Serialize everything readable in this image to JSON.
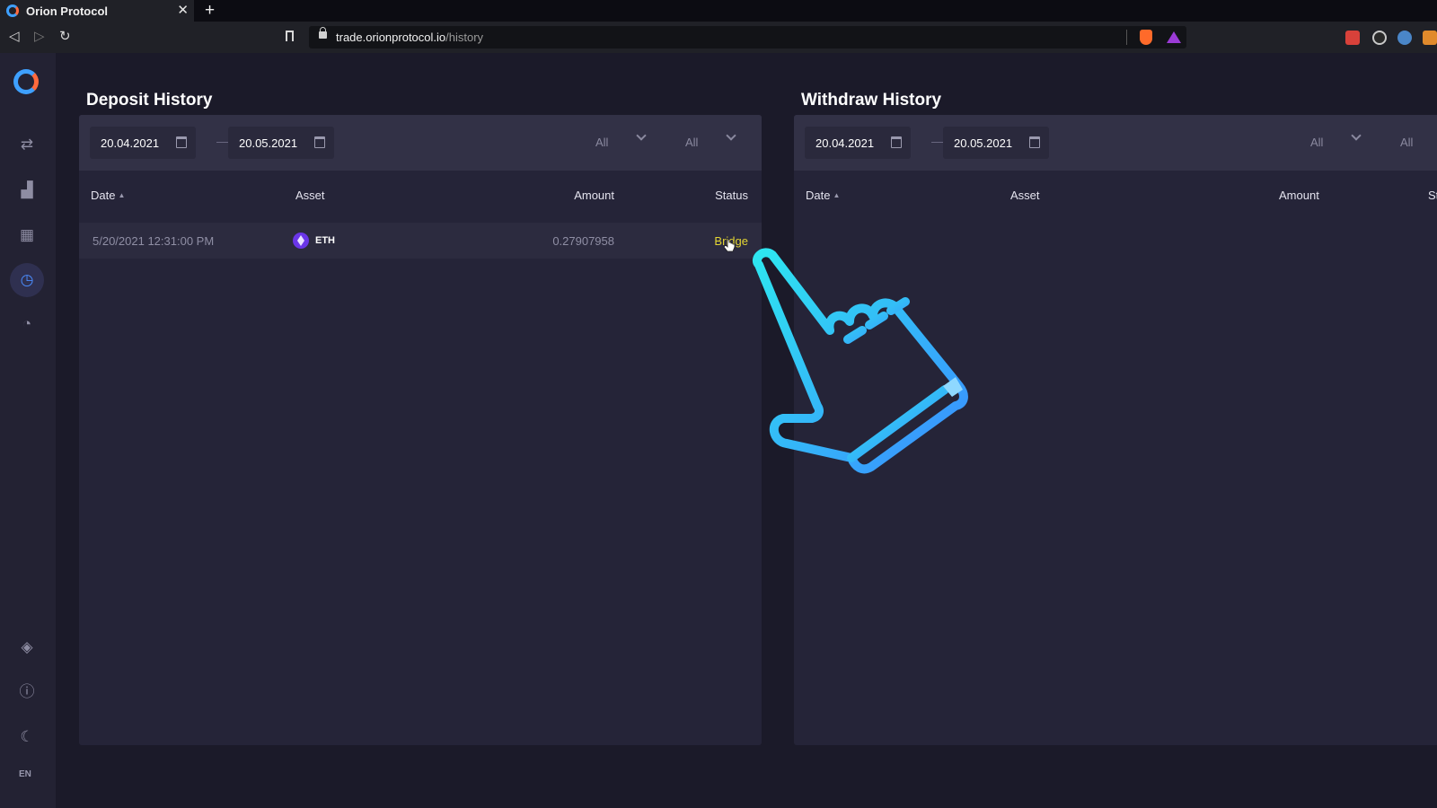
{
  "browser": {
    "tab_title": "Orion Protocol",
    "tab_close": "✕",
    "new_tab": "+",
    "back": "◁",
    "forward": "▷",
    "reload": "↻",
    "url_host": "trade.orionprotocol.io",
    "url_path": "/history"
  },
  "sidebar": {
    "icons": [
      "swap-icon",
      "chart-icon",
      "dashboard-icon",
      "history-icon",
      "portfolio-icon",
      "binance-icon",
      "help-icon",
      "theme-icon"
    ],
    "language": "EN"
  },
  "deposit": {
    "title": "Deposit History",
    "date_from": "20.04.2021",
    "date_to": "20.05.2021",
    "select_1": "All",
    "select_2": "All",
    "columns": {
      "date": "Date",
      "asset": "Asset",
      "amount": "Amount",
      "status": "Status"
    },
    "rows": [
      {
        "date": "5/20/2021 12:31:00 PM",
        "asset": "ETH",
        "amount": "0.27907958",
        "status": "Bridge"
      }
    ]
  },
  "withdraw": {
    "title": "Withdraw History",
    "date_from": "20.04.2021",
    "date_to": "20.05.2021",
    "select_1": "All",
    "select_2": "All",
    "columns": {
      "date": "Date",
      "asset": "Asset",
      "amount": "Amount",
      "status": "St"
    }
  },
  "colors": {
    "accent": "#3ea0ff",
    "status_bridge": "#e3d533",
    "hand_gradient_start": "#2ee6f0",
    "hand_gradient_end": "#3a8cff"
  }
}
